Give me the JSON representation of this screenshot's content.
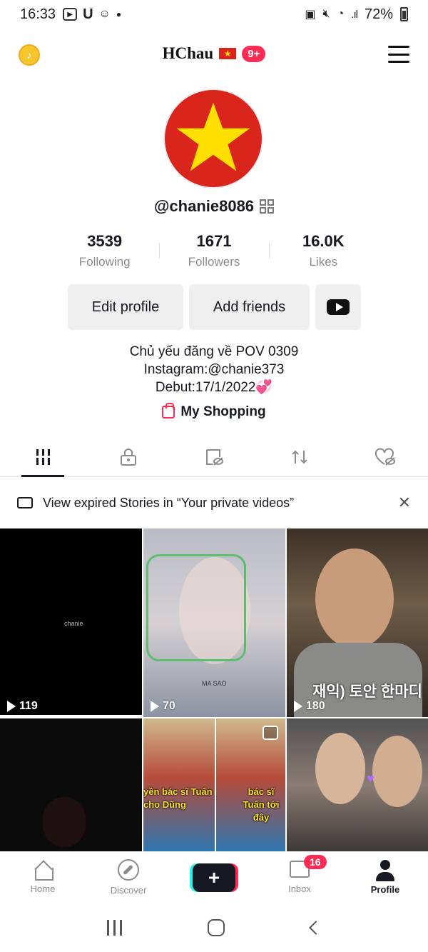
{
  "status_bar": {
    "time": "16:33",
    "battery": "72%"
  },
  "header": {
    "title": "HChau",
    "notif_badge": "9+"
  },
  "profile": {
    "username": "@chanie8086",
    "stats": [
      {
        "value": "3539",
        "label": "Following"
      },
      {
        "value": "1671",
        "label": "Followers"
      },
      {
        "value": "16.0K",
        "label": "Likes"
      }
    ],
    "buttons": {
      "edit": "Edit profile",
      "add_friends": "Add friends"
    },
    "bio": [
      "Chủ yếu đăng về POV 0309",
      "Instagram:@chanie373",
      "Debut:17/1/2022💞"
    ],
    "shopping": "My Shopping"
  },
  "banner": {
    "text": "View expired Stories in “Your private videos”"
  },
  "videos": [
    {
      "views": "119",
      "overlay": "chanie"
    },
    {
      "views": "70",
      "overlay": "MA SAO"
    },
    {
      "views": "180",
      "overlay": "재익) 토안 한마디"
    },
    {
      "views": ""
    },
    {
      "views": "",
      "caption1": "yền bác sĩ Tuấn cho Dũng",
      "caption2": "bác sĩ Tuấn tới đây"
    },
    {
      "views": ""
    }
  ],
  "bottom_nav": {
    "home": "Home",
    "discover": "Discover",
    "create": "+",
    "inbox": "Inbox",
    "inbox_badge": "16",
    "profile": "Profile"
  },
  "colors": {
    "accent": "#fe2c55",
    "cyan": "#25f4ee",
    "flag_red": "#da251d",
    "flag_yellow": "#ffdf00"
  }
}
